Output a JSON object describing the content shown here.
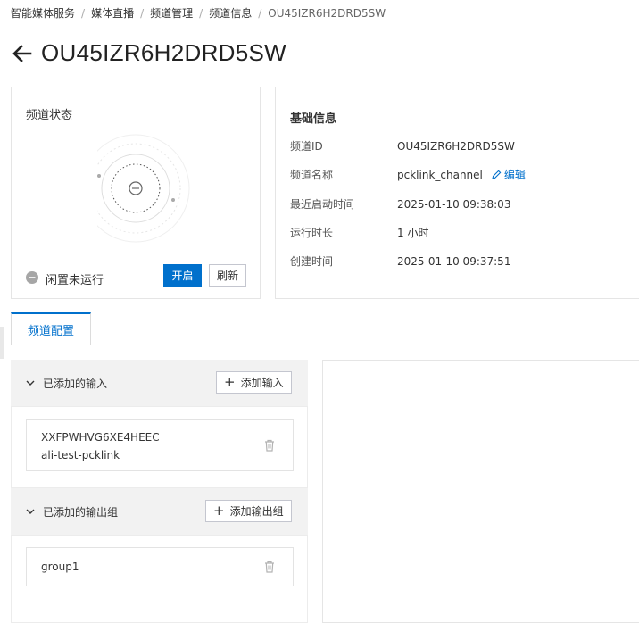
{
  "breadcrumb": {
    "items": [
      "智能媒体服务",
      "媒体直播",
      "频道管理",
      "频道信息"
    ],
    "current": "OU45IZR6H2DRD5SW",
    "separator": "/"
  },
  "page": {
    "title": "OU45IZR6H2DRD5SW"
  },
  "status_card": {
    "title": "频道状态",
    "status_text": "闲置未运行",
    "start_label": "开启",
    "refresh_label": "刷新"
  },
  "info_card": {
    "title": "基础信息",
    "rows": [
      {
        "label": "频道ID",
        "value": "OU45IZR6H2DRD5SW"
      },
      {
        "label": "频道名称",
        "value": "pcklink_channel",
        "action": "编辑"
      },
      {
        "label": "最近启动时间",
        "value": "2025-01-10 09:38:03"
      },
      {
        "label": "运行时长",
        "value": "1 小时"
      },
      {
        "label": "创建时间",
        "value": "2025-01-10 09:37:51"
      }
    ]
  },
  "tabs": [
    {
      "label": "频道配置",
      "active": true
    }
  ],
  "inputs_section": {
    "title": "已添加的输入",
    "add_label": "添加输入",
    "items": [
      {
        "id": "XXFPWHVG6XE4HEEC",
        "name": "ali-test-pcklink"
      }
    ]
  },
  "outputs_section": {
    "title": "已添加的输出组",
    "add_label": "添加输出组",
    "items": [
      {
        "name": "group1"
      }
    ]
  },
  "colors": {
    "primary": "#0070cc",
    "border": "#e5e5e5",
    "panel_bg": "#f2f2f2",
    "icon_gray": "#999999"
  },
  "icons": {
    "back": "arrow-left-icon",
    "status": "minus-circle-icon",
    "edit": "pencil-icon",
    "collapse": "chevron-down-icon",
    "add": "plus-icon",
    "delete": "trash-icon"
  }
}
